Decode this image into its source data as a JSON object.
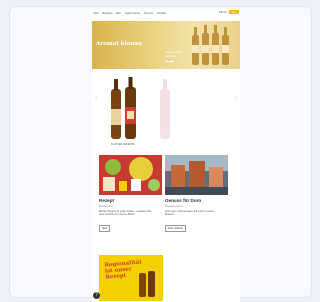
{
  "nav": {
    "items": [
      "Start",
      "Brauerei",
      "Bier",
      "Gastronomie",
      "Termine",
      "Kontakt"
    ]
  },
  "util": {
    "lang": "DE EN",
    "shop_label": "Shop"
  },
  "hero": {
    "title": "Aromat klonau",
    "line1": "Das Aroma des",
    "line2": "Sommers",
    "badge": "NEU"
  },
  "slider": {
    "caption": "KLOSTER ANDECHS"
  },
  "blocks": [
    {
      "title": "Rezept",
      "subtitle": "Frische Ideen",
      "text": "Bierige Rezepte für jeden Anlass – entdecken Sie neue Gerichte mit unseren Bieren.",
      "button": "Mehr"
    },
    {
      "title": "Genuss für Dorn",
      "subtitle": "Brauerei erleben",
      "text": "Führungen, Verkostungen und mehr in unserer Brauerei.",
      "button": "Mehr erfahren"
    }
  ],
  "promo": {
    "line1": "Regionalität",
    "line2": "ist unser",
    "line3": "Rezept"
  },
  "help": {
    "label": "?"
  }
}
